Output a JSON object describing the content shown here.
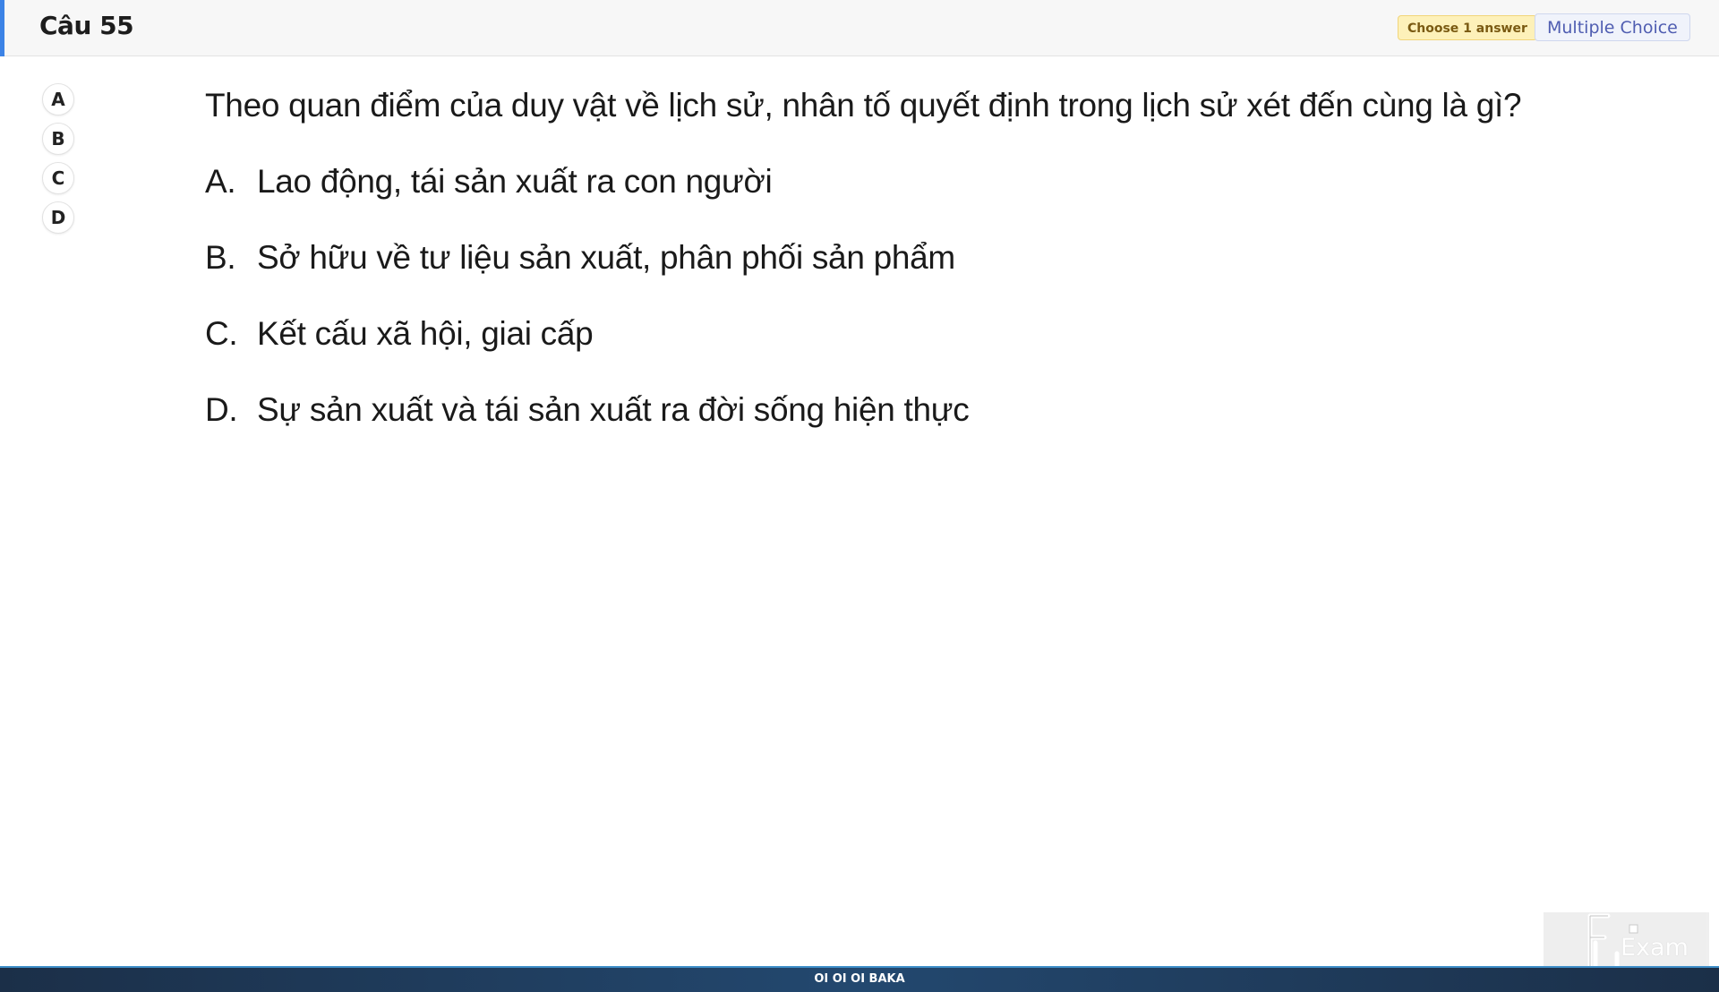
{
  "header": {
    "title": "Câu 55",
    "badge_choose": "Choose 1 answer",
    "badge_type": "Multiple Choice",
    "accent_color": "#3c83e6"
  },
  "answer_selector": [
    {
      "label": "A"
    },
    {
      "label": "B"
    },
    {
      "label": "C"
    },
    {
      "label": "D"
    }
  ],
  "question": {
    "text": "Theo quan điểm của duy vật về lịch sử, nhân tố quyết định trong lịch sử xét đến cùng là gì?",
    "options": [
      {
        "letter": "A.",
        "text": "Lao động, tái sản xuất ra con người"
      },
      {
        "letter": "B.",
        "text": "Sở hữu về tư liệu sản xuất, phân phối sản phẩm"
      },
      {
        "letter": "C.",
        "text": "Kết cấu xã hội, giai cấp"
      },
      {
        "letter": "D.",
        "text": "Sự sản xuất và tái sản xuất ra đời sống hiện thực"
      }
    ]
  },
  "footer": {
    "text": "OI OI OI BAKA"
  },
  "watermark": {
    "logo_text": "FU",
    "word": "Exam"
  }
}
